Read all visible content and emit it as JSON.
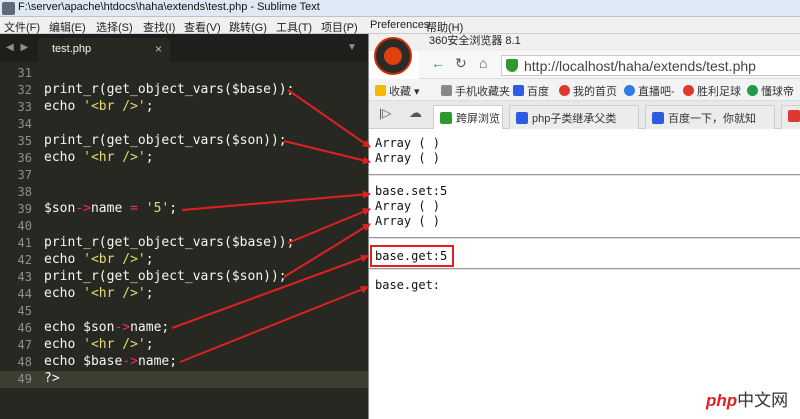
{
  "titlebar": {
    "title": "F:\\server\\apache\\htdocs\\haha\\extends\\test.php - Sublime Text"
  },
  "menu": [
    "文件(F)",
    "编辑(E)",
    "选择(S)",
    "查找(I)",
    "查看(V)",
    "跳转(G)",
    "工具(T)",
    "项目(P)",
    "Preferences",
    "帮助(H)"
  ],
  "editor_tab": {
    "name": "test.php",
    "close": "×"
  },
  "nav_arrows": "◀ ▶",
  "dropdown_glyph": "▼",
  "code": {
    "lines": [
      {
        "n": "31",
        "text": ""
      },
      {
        "n": "32",
        "text": "print_r(get_object_vars($base));"
      },
      {
        "n": "33",
        "text": "echo '<br />';"
      },
      {
        "n": "34",
        "text": ""
      },
      {
        "n": "35",
        "text": "print_r(get_object_vars($son));"
      },
      {
        "n": "36",
        "text": "echo '<hr />';"
      },
      {
        "n": "37",
        "text": ""
      },
      {
        "n": "38",
        "text": ""
      },
      {
        "n": "39",
        "text": "$son->name = '5';"
      },
      {
        "n": "40",
        "text": ""
      },
      {
        "n": "41",
        "text": "print_r(get_object_vars($base));"
      },
      {
        "n": "42",
        "text": "echo '<br />';"
      },
      {
        "n": "43",
        "text": "print_r(get_object_vars($son));"
      },
      {
        "n": "44",
        "text": "echo '<hr />';"
      },
      {
        "n": "45",
        "text": ""
      },
      {
        "n": "46",
        "text": "echo $son->name;"
      },
      {
        "n": "47",
        "text": "echo '<hr />';"
      },
      {
        "n": "48",
        "text": "echo $base->name;"
      },
      {
        "n": "49",
        "text": "?>"
      }
    ]
  },
  "browser": {
    "title": "360安全浏览器 8.1",
    "url": "http://localhost/haha/extends/test.php",
    "bookmarks": [
      "收藏",
      "手机收藏夹",
      "百度",
      "我的首页",
      "直播吧-",
      "胜利足球",
      "懂球帝"
    ],
    "tabs": [
      "跨屏浏览",
      "php子类继承父类",
      "百度一下，你就知",
      ""
    ],
    "output": [
      "Array ( )",
      "Array ( )",
      "base.set:5",
      "Array ( )",
      "Array ( )",
      "base.get:5",
      "base.get:"
    ]
  },
  "watermark": {
    "part1": "php",
    "part2": "中文网"
  },
  "colors": {
    "editor_bg": "#272822",
    "keyword": "#f92672",
    "string": "#e6db74",
    "arrow": "#e02020",
    "browser_green": "#2e9a2e"
  }
}
